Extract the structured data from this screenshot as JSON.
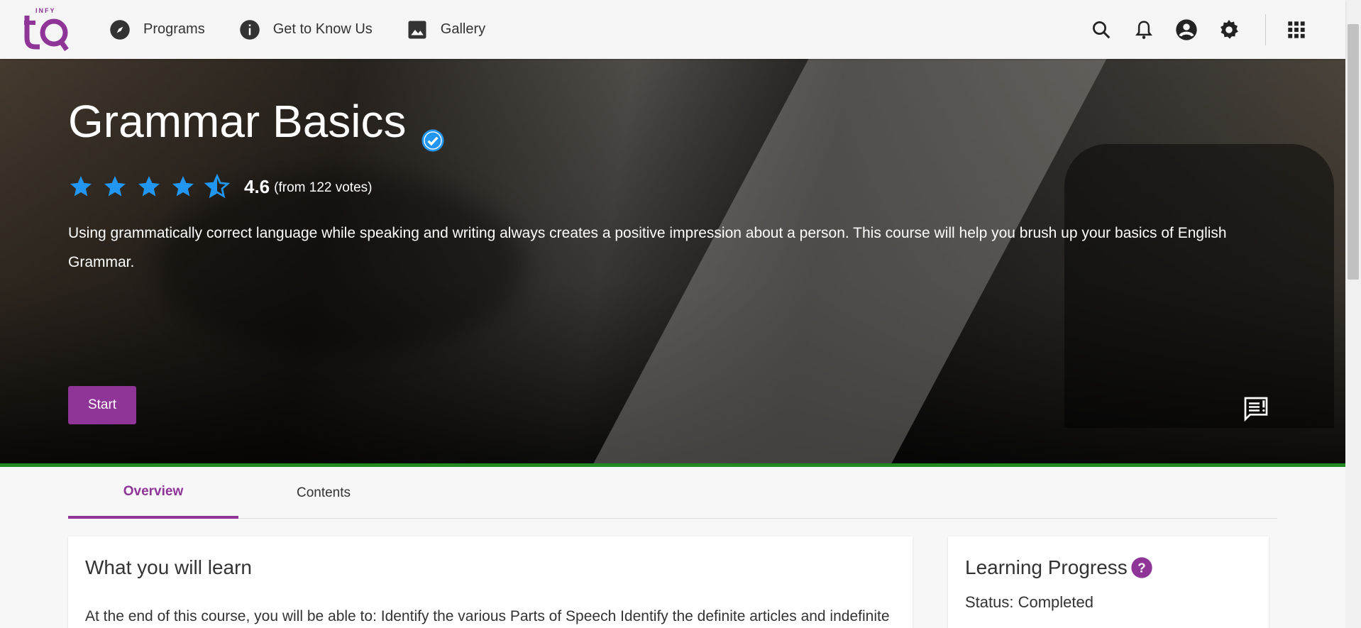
{
  "header": {
    "logo_text": "INFY TQ",
    "nav": [
      {
        "label": "Programs",
        "icon": "compass-icon"
      },
      {
        "label": "Get to Know Us",
        "icon": "info-icon"
      },
      {
        "label": "Gallery",
        "icon": "image-icon"
      }
    ],
    "right_icons": [
      "search-icon",
      "bell-icon",
      "account-icon",
      "gear-icon",
      "apps-grid-icon"
    ]
  },
  "course": {
    "title": "Grammar Basics",
    "rating": "4.6",
    "rating_value": 4.6,
    "rating_max": 5,
    "votes": "(from 122 votes)",
    "description": "Using grammatically correct language while speaking and writing always creates a positive impression about a person. This course will help you brush up your basics of English Grammar.",
    "start_label": "Start"
  },
  "tabs": [
    {
      "label": "Overview",
      "active": true
    },
    {
      "label": "Contents",
      "active": false
    }
  ],
  "learn": {
    "heading": "What you will learn",
    "text": "At the end of this course, you will be able to: Identify the various Parts of Speech Identify the definite articles and indefinite"
  },
  "progress": {
    "heading": "Learning Progress",
    "status": "Status: Completed"
  },
  "colors": {
    "accent": "#8e3597",
    "star": "#2196f3",
    "hero_line": "#1f8a1f"
  }
}
